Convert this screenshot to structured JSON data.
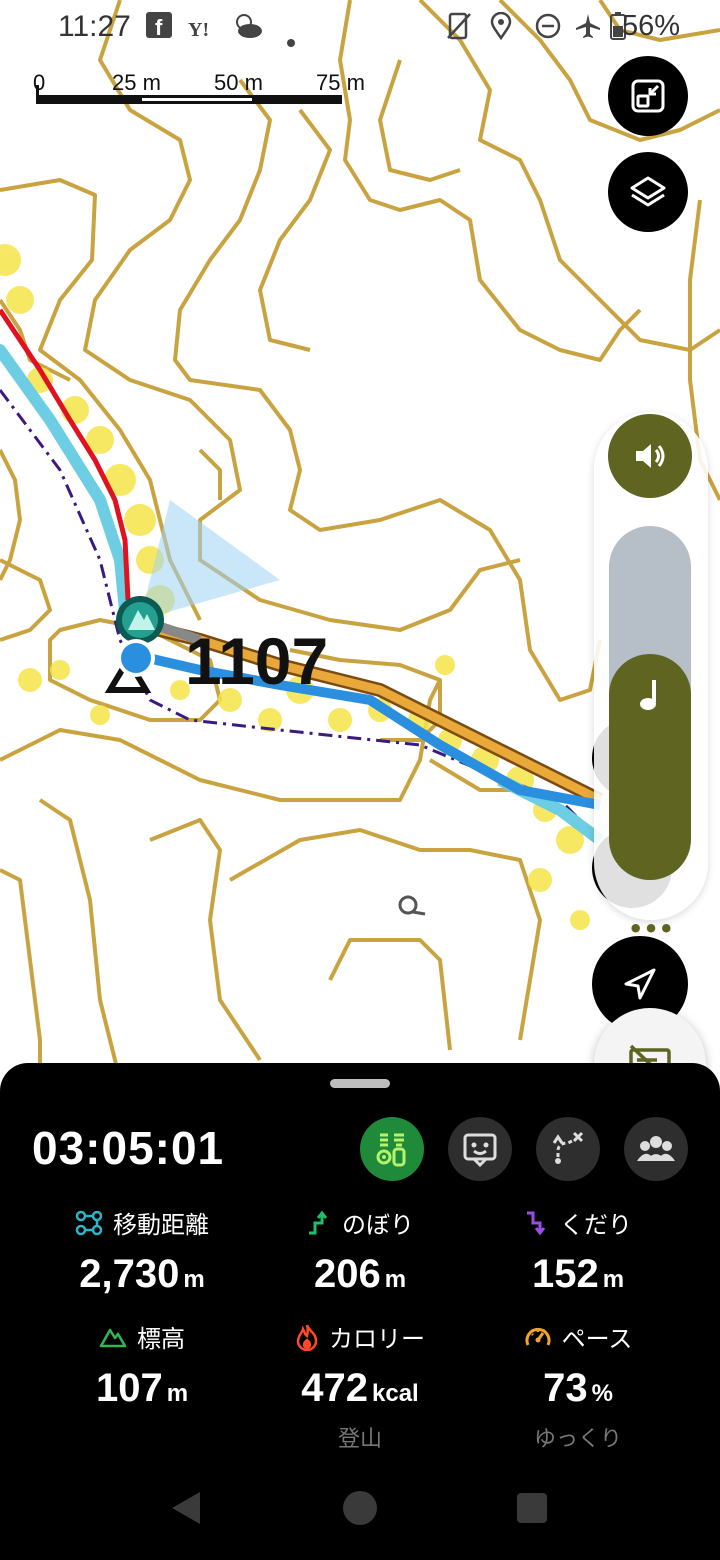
{
  "status_bar": {
    "time": "11:27",
    "battery_percent": "56%",
    "icons": [
      "facebook-icon",
      "yahoo-icon",
      "weather-icon",
      "dot-icon",
      "vibrate-off-icon",
      "location-icon",
      "dnd-icon",
      "airplane-icon",
      "battery-icon"
    ]
  },
  "map": {
    "scale_labels": [
      "0",
      "25 m",
      "50 m",
      "75 m"
    ],
    "elevation_label": "1107",
    "colors": {
      "contour": "#c9a33f",
      "route_red": "#e0121f",
      "route_orange": "#e9a93a",
      "track_blue": "#2b8fe0",
      "track_cyan": "#6ccde3",
      "heat": "#f6e44a",
      "dash": "#3a1a80"
    }
  },
  "map_controls": {
    "fullscreen_icon": "exit-fullscreen-icon",
    "layers_icon": "layers-icon",
    "sound_icon": "speaker-icon",
    "music_icon": "music-note-icon",
    "more_label": "•••",
    "navigate_icon": "navigation-arrow-icon",
    "subtitle_off_icon": "subtitles-off-icon"
  },
  "sheet": {
    "elapsed_time": "03:05:01",
    "action_icons": [
      "trail-icon",
      "face-icon",
      "route-off-icon",
      "group-icon"
    ],
    "stats": [
      {
        "label": "移動距離",
        "value": "2,730",
        "unit": "m",
        "icon": "distance-icon",
        "color": "#2ab8c8"
      },
      {
        "label": "のぼり",
        "value": "206",
        "unit": "m",
        "icon": "ascent-icon",
        "color": "#1fbf6a"
      },
      {
        "label": "くだり",
        "value": "152",
        "unit": "m",
        "icon": "descent-icon",
        "color": "#9a4ee6"
      },
      {
        "label": "標高",
        "value": "107",
        "unit": "m",
        "icon": "elevation-icon",
        "color": "#2fb84f"
      },
      {
        "label": "カロリー",
        "value": "472",
        "unit": "kcal",
        "icon": "flame-icon",
        "color": "#ff4a2a",
        "sub": "登山"
      },
      {
        "label": "ペース",
        "value": "73",
        "unit": "%",
        "icon": "speedometer-icon",
        "color": "#f0a42a",
        "sub": "ゆっくり"
      }
    ]
  }
}
